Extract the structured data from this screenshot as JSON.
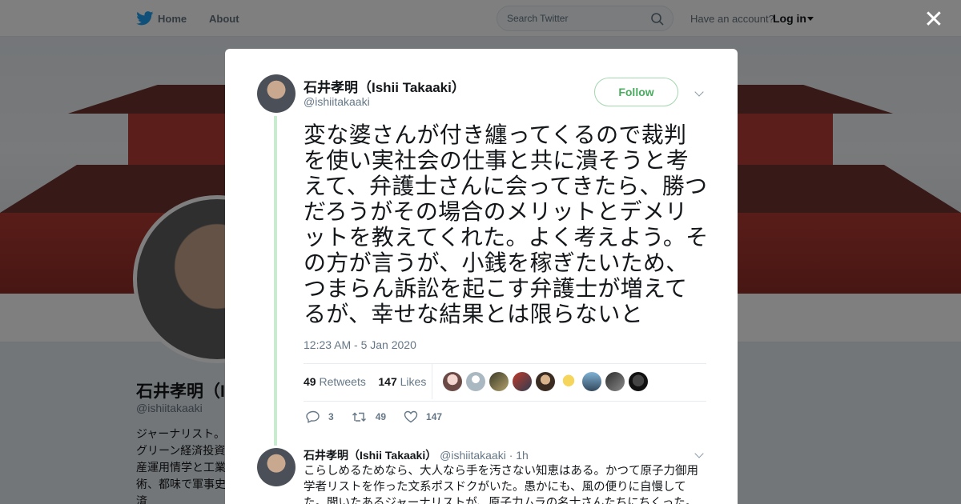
{
  "nav": {
    "home": "Home",
    "about": "About",
    "search_placeholder": "Search Twitter",
    "have_account": "Have an account?",
    "login": "Log in"
  },
  "profile": {
    "name": "石井孝明（I",
    "handle": "@ishiitakaaki",
    "bio": "ジャーナリスト。題、グリーン経済投資と資産運用情学と工業技術、都味で軍事史と経済"
  },
  "tweet": {
    "author_name": "石井孝明（Ishii Takaaki）",
    "author_handle": "@ishiitakaaki",
    "follow_label": "Follow",
    "text": "変な婆さんが付き纏ってくるので裁判を使い実社会の仕事と共に潰そうと考えて、弁護士さんに会ってきたら、勝つだろうがその場合のメリットとデメリットを教えてくれた。よく考えよう。その方が言うが、小銭を稼ぎたいため、つまらん訴訟を起こす弁護士が増えてるが、幸せな結果とは限らないと",
    "timestamp": "12:23 AM - 5 Jan 2020",
    "retweets_count": "49",
    "retweets_label": "Retweets",
    "likes_count": "147",
    "likes_label": "Likes",
    "replies_action": "3",
    "retweets_action": "49",
    "likes_action": "147"
  },
  "reply": {
    "author_name": "石井孝明（Ishii Takaaki）",
    "author_handle": "@ishiitakaaki",
    "time": "· 1h",
    "text": "こらしめるためなら、大人なら手を汚さない知恵はある。かつて原子力御用学者リストを作った文系ポスドクがいた。愚かにも、風の便りに自慢してた。聞いたあるジャーナリストが、原子力ムラの名士さんたちにちくった。教授たち"
  },
  "colors": {
    "twitter_blue": "#1da1f2",
    "follow_green": "#4aab5f",
    "thread_line": "#c9ecd0"
  },
  "icons": [
    "twitter-bird-icon",
    "search-icon",
    "close-icon",
    "chevron-down-icon",
    "reply-icon",
    "retweet-icon",
    "like-icon"
  ]
}
